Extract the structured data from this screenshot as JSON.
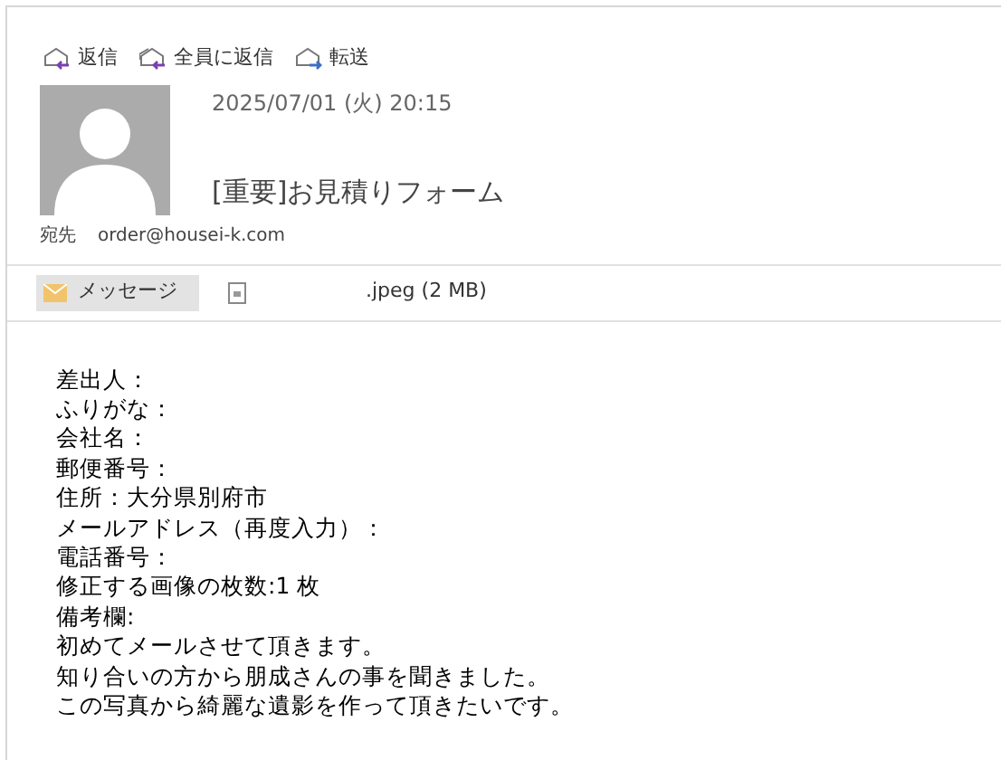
{
  "toolbar": [
    {
      "kind": "reply",
      "label": "返信"
    },
    {
      "kind": "reply_all",
      "label": "全員に返信"
    },
    {
      "kind": "forward",
      "label": "転送"
    }
  ],
  "message": {
    "date": "2025/07/01 (火) 20:15",
    "subject": "[重要]お見積りフォーム",
    "to_label": "宛先",
    "to": "order@housei-k.com"
  },
  "attachments": [
    {
      "kind": "message",
      "label": "メッセージ",
      "selected": true
    },
    {
      "kind": "file",
      "label": ".jpeg (2 MB)",
      "selected": false
    }
  ],
  "body": [
    "差出人：",
    "ふりがな：",
    "会社名：",
    "郵便番号：",
    "住所：大分県別府市",
    "メールアドレス（再度入力）：",
    "電話番号：",
    "修正する画像の枚数:1 枚",
    "備考欄:",
    "初めてメールさせて頂きます。",
    "知り合いの方から朋成さんの事を聞きました。",
    "この写真から綺麗な遺影を作って頂きたいです。"
  ]
}
